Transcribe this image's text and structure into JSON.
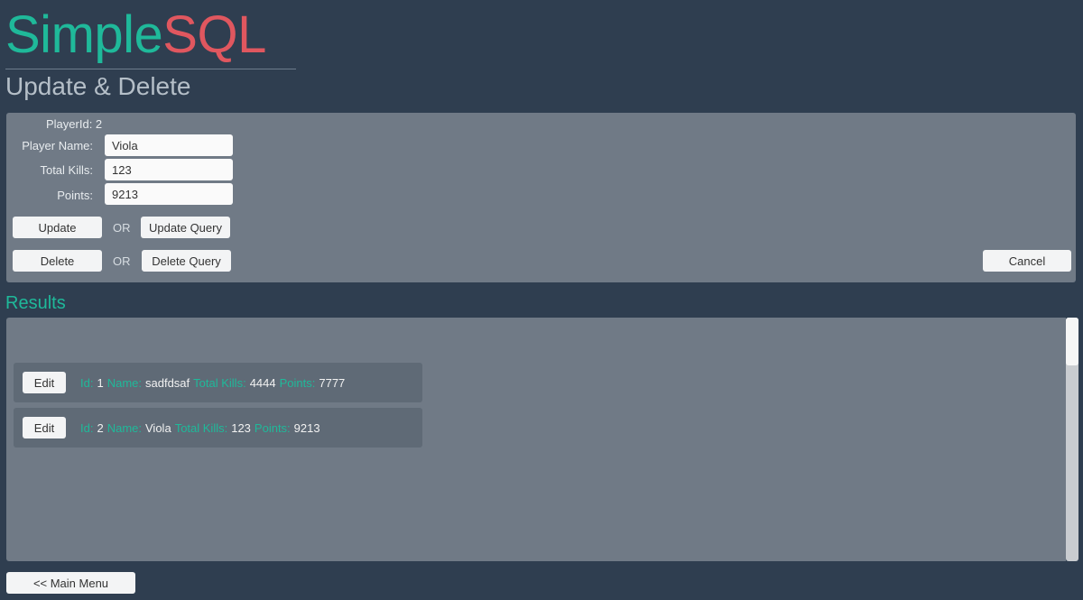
{
  "app": {
    "logo_part1": "Simple",
    "logo_part2": "SQL",
    "subtitle": "Update & Delete"
  },
  "form": {
    "player_id_label": "PlayerId: 2",
    "name_label": "Player Name:",
    "name_value": "Viola",
    "kills_label": "Total Kills:",
    "kills_value": "123",
    "points_label": "Points:",
    "points_value": "9213",
    "update": "Update",
    "or1": "OR",
    "update_query": "Update Query",
    "delete": "Delete",
    "or2": "OR",
    "delete_query": "Delete Query",
    "cancel": "Cancel"
  },
  "results": {
    "title": "Results",
    "rows": [
      {
        "edit": "Edit",
        "id_label": "Id:",
        "id": "1",
        "name_label": "Name:",
        "name": "sadfdsaf",
        "kills_label": "Total Kills:",
        "kills": "4444",
        "points_label": "Points:",
        "points": "7777"
      },
      {
        "edit": "Edit",
        "id_label": "Id:",
        "id": "2",
        "name_label": "Name:",
        "name": "Viola",
        "kills_label": "Total Kills:",
        "kills": "123",
        "points_label": "Points:",
        "points": "9213"
      }
    ]
  },
  "footer": {
    "main_menu": "<< Main Menu"
  }
}
